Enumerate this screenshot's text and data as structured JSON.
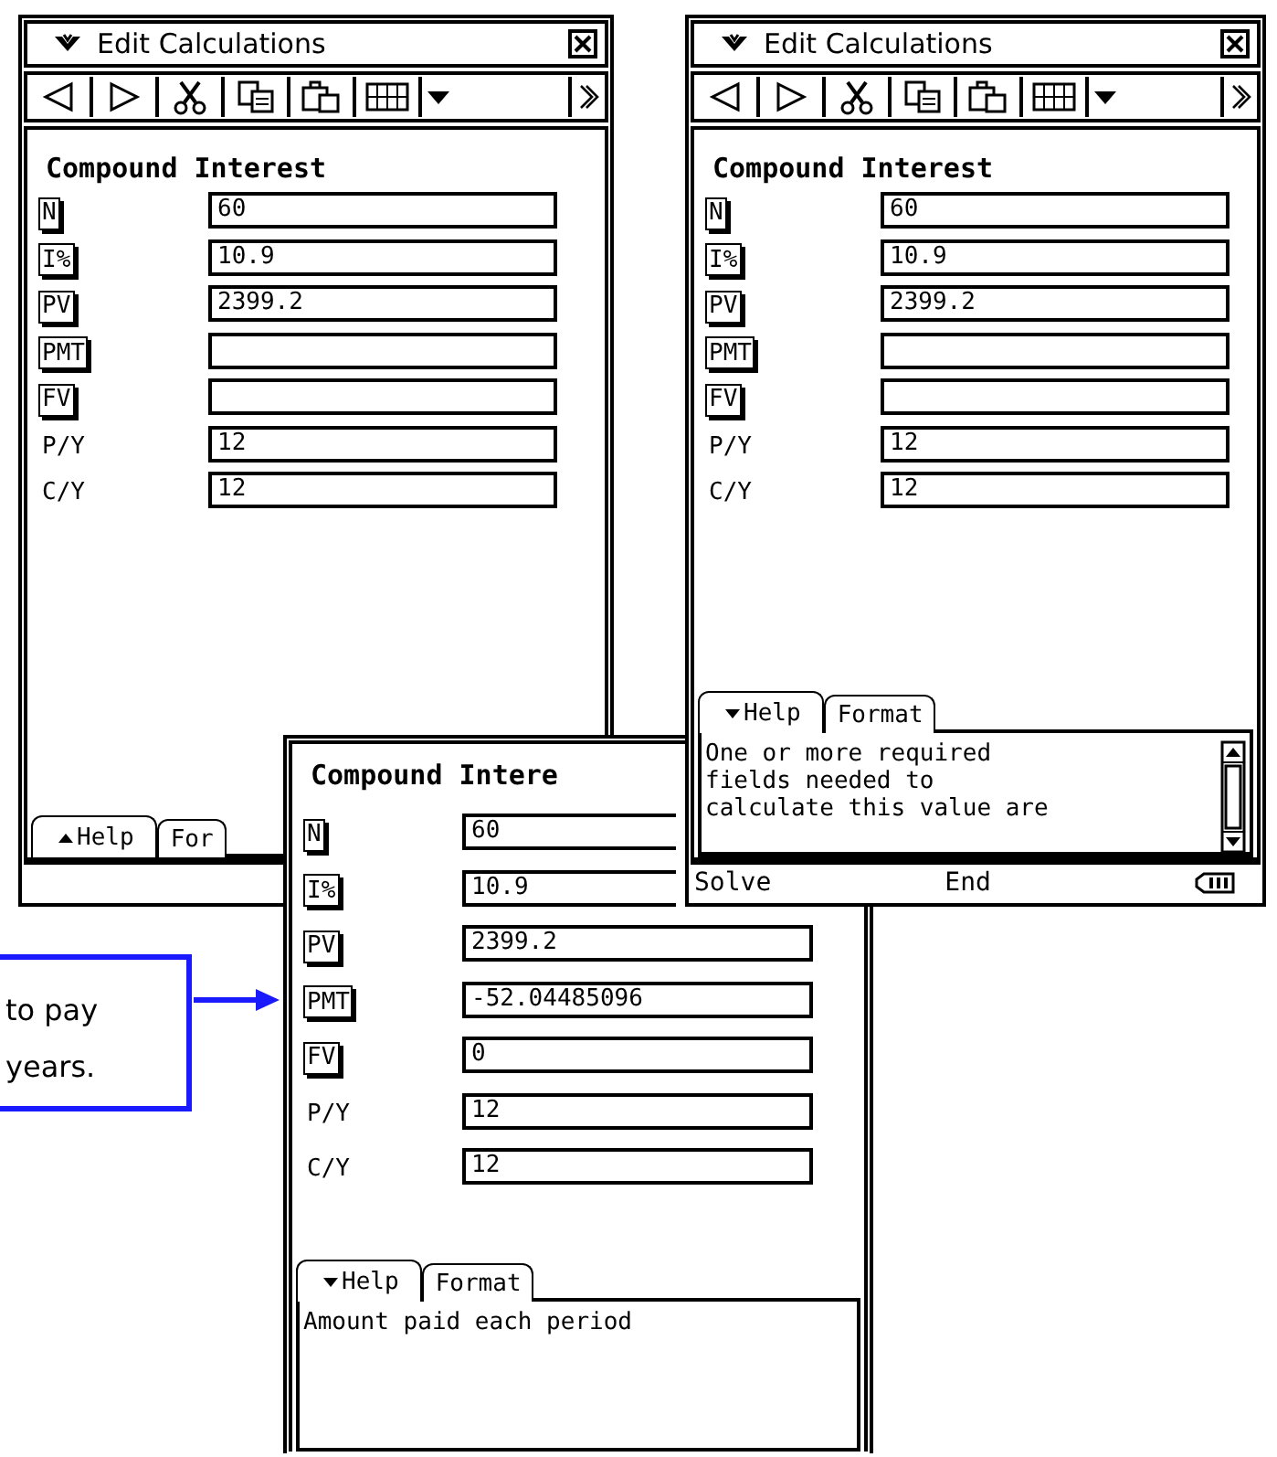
{
  "windows": [
    {
      "title": "Edit Calculations",
      "heading": "Compound Interest",
      "fields": [
        {
          "label": "N",
          "kind": "key",
          "value": "60"
        },
        {
          "label": "I%",
          "kind": "key",
          "value": "10.9"
        },
        {
          "label": "PV",
          "kind": "key",
          "value": "2399.2"
        },
        {
          "label": "PMT",
          "kind": "key"
        },
        {
          "label": "FV",
          "kind": "key"
        },
        {
          "label": "P/Y",
          "kind": "plain",
          "value": "12"
        },
        {
          "label": "C/Y",
          "kind": "plain",
          "value": "12"
        }
      ],
      "tabs": [
        {
          "label": "Help",
          "selected": true,
          "expanded": false
        },
        {
          "label": "For",
          "selected": false
        }
      ]
    },
    {
      "title": "Edit Calculations",
      "heading": "Compound Interest",
      "fields": [
        {
          "label": "N",
          "kind": "key",
          "value": "60"
        },
        {
          "label": "I%",
          "kind": "key",
          "value": "10.9"
        },
        {
          "label": "PV",
          "kind": "key",
          "value": "2399.2"
        },
        {
          "label": "PMT",
          "kind": "key"
        },
        {
          "label": "FV",
          "kind": "key"
        },
        {
          "label": "P/Y",
          "kind": "plain",
          "value": "12"
        },
        {
          "label": "C/Y",
          "kind": "plain",
          "value": "12"
        }
      ],
      "tabs": [
        {
          "label": "Help",
          "selected": true,
          "expanded": true
        },
        {
          "label": "Format",
          "selected": false
        }
      ],
      "help_lines": [
        "One or more required",
        "fields needed to",
        "calculate this value are"
      ],
      "status_bar": {
        "left": "Solve",
        "middle": "End"
      }
    },
    {
      "heading": "Compound Intere",
      "fields": [
        {
          "label": "N",
          "kind": "key",
          "value": "60"
        },
        {
          "label": "I%",
          "kind": "key",
          "value": "10.9"
        },
        {
          "label": "PV",
          "kind": "key",
          "value": "2399.2"
        },
        {
          "label": "PMT",
          "kind": "key",
          "value": "-52.04485096"
        },
        {
          "label": "FV",
          "kind": "key",
          "value": "0"
        },
        {
          "label": "P/Y",
          "kind": "plain",
          "value": "12"
        },
        {
          "label": "C/Y",
          "kind": "plain",
          "value": "12"
        }
      ],
      "tabs": [
        {
          "label": "Help",
          "selected": true,
          "expanded": true
        },
        {
          "label": "Format",
          "selected": false
        }
      ],
      "help_lines": [
        "Amount paid each period"
      ]
    }
  ],
  "callout": {
    "lines": [
      "to pay",
      "years."
    ]
  }
}
